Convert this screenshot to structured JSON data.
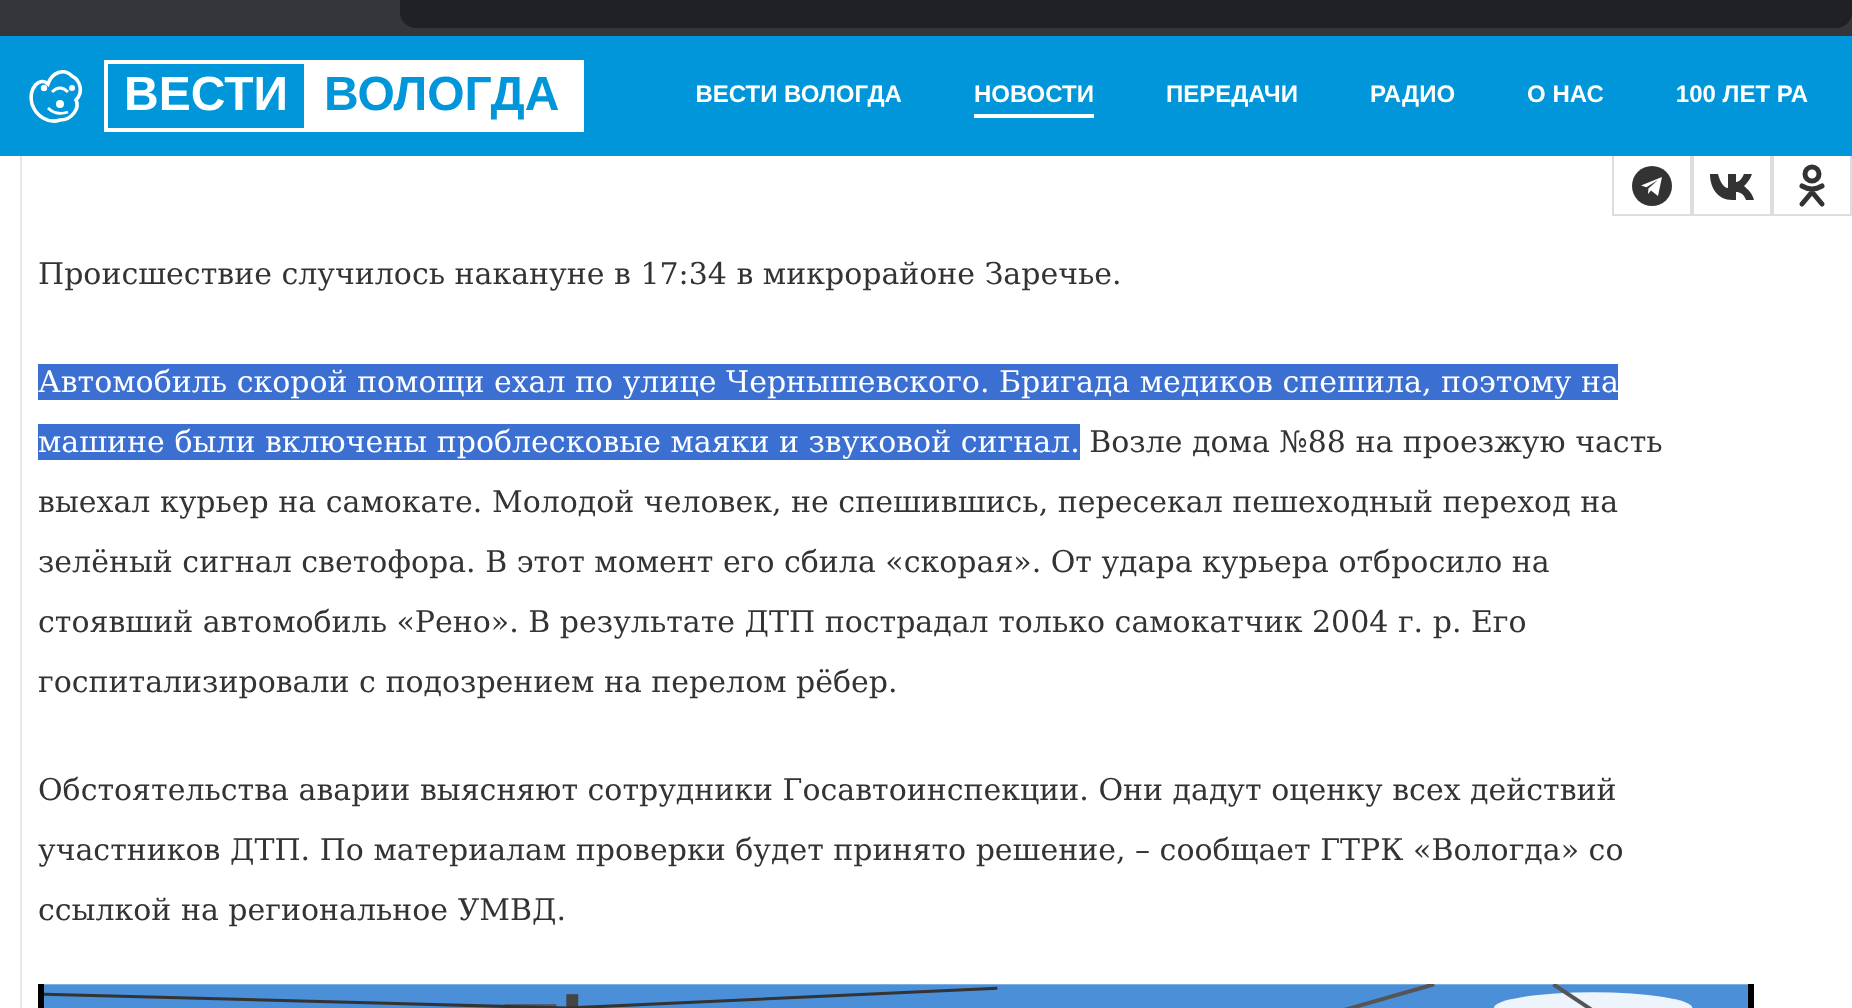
{
  "logo": {
    "part_1": "ВЕСТИ",
    "part_2": "ВОЛОГДА"
  },
  "nav": [
    {
      "label": "ВЕСТИ ВОЛОГДА",
      "selected": false
    },
    {
      "label": "НОВОСТИ",
      "selected": true
    },
    {
      "label": "ПЕРЕДАЧИ",
      "selected": false
    },
    {
      "label": "РАДИО",
      "selected": false
    },
    {
      "label": "О НАС",
      "selected": false
    },
    {
      "label": "100 ЛЕТ РА",
      "selected": false
    }
  ],
  "share": [
    {
      "kind": "telegram"
    },
    {
      "kind": "vk"
    },
    {
      "kind": "ok"
    }
  ],
  "article": {
    "paragraphs": [
      [
        {
          "text": "Происшествие случилось накануне в 17:34 в микрорайоне Заречье.",
          "selected": false
        }
      ],
      [
        {
          "text": "Автомобиль скорой помощи ехал по улице Чернышевского. Бригада медиков спешила, поэтому на машине были включены проблесковые маяки и звуковой сигнал.",
          "selected": true
        },
        {
          "text": " Возле дома №88 на проезжую часть выехал курьер на самокате. Молодой человек, не спешившись, пересекал пешеходный переход на зелёный сигнал светофора. В этот момент его сбила «скорая». От удара курьера отбросило на стоявший автомобиль «Рено». В результате ДТП пострадал только самокатчик 2004 г. р. Его госпитализировали с подозрением на перелом рёбер.",
          "selected": false
        }
      ],
      [
        {
          "text": "Обстоятельства аварии выясняют сотрудники Госавтоинспекции. Они дадут оценку всех действий участников ДТП. По материалам проверки будет принято решение, – сообщает ГТРК «Вологда» со ссылкой на региональное УМВД.",
          "selected": false
        }
      ]
    ],
    "photo": {
      "kind": "picture"
    }
  }
}
